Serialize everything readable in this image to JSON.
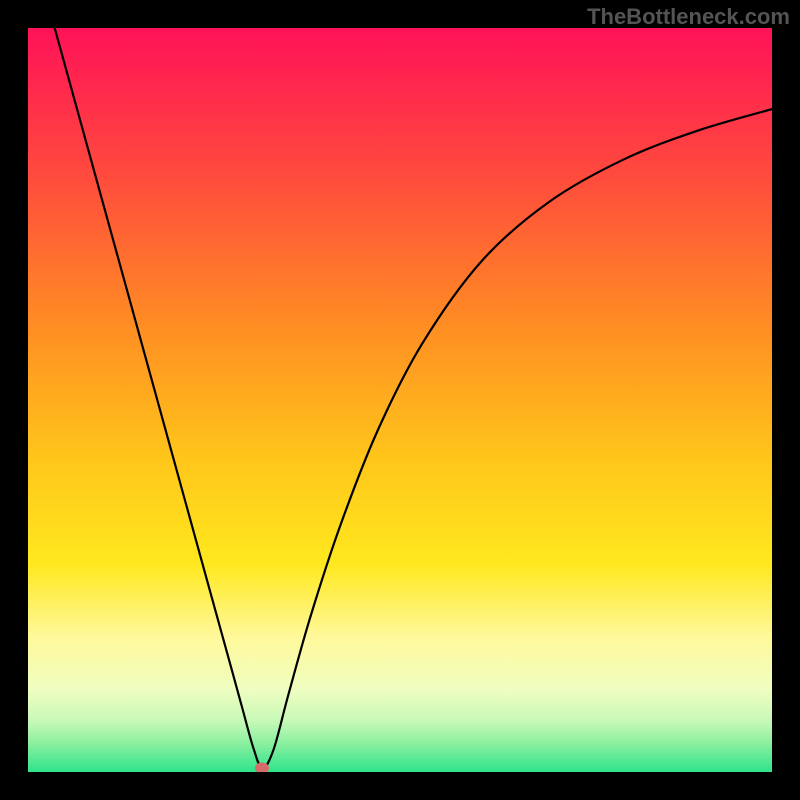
{
  "branding": "TheBottleneck.com",
  "chart_data": {
    "type": "line",
    "title": "",
    "xlabel": "",
    "ylabel": "",
    "xlim": [
      0,
      100
    ],
    "ylim": [
      0,
      100
    ],
    "grid": false,
    "legend": false,
    "gradient_stops": [
      {
        "offset": 0,
        "color": "#ff1258"
      },
      {
        "offset": 0.2,
        "color": "#ff4b3d"
      },
      {
        "offset": 0.4,
        "color": "#ff8d23"
      },
      {
        "offset": 0.58,
        "color": "#ffc61a"
      },
      {
        "offset": 0.72,
        "color": "#ffe81e"
      },
      {
        "offset": 0.82,
        "color": "#fff99c"
      },
      {
        "offset": 0.89,
        "color": "#eefec0"
      },
      {
        "offset": 0.93,
        "color": "#c9f9b8"
      },
      {
        "offset": 0.96,
        "color": "#8ef0a0"
      },
      {
        "offset": 1.0,
        "color": "#2fe38b"
      }
    ],
    "series": [
      {
        "name": "bottleneck-curve",
        "color": "#000000",
        "x": [
          0,
          4,
          8,
          12,
          16,
          20,
          24,
          27.4,
          28.8,
          30.3,
          31.5,
          33,
          35,
          38,
          42,
          47,
          53,
          61,
          70,
          80,
          90,
          100
        ],
        "y": [
          113,
          98.5,
          84,
          69.5,
          55,
          40.5,
          26,
          13.7,
          8.6,
          3.2,
          0.5,
          3.0,
          10.4,
          21.0,
          33.2,
          45.9,
          57.6,
          68.7,
          76.6,
          82.3,
          86.2,
          89.1
        ]
      }
    ],
    "annotations": [
      {
        "name": "min-marker",
        "x": 31.5,
        "y": 0.5,
        "color": "#d86a6a"
      }
    ]
  }
}
